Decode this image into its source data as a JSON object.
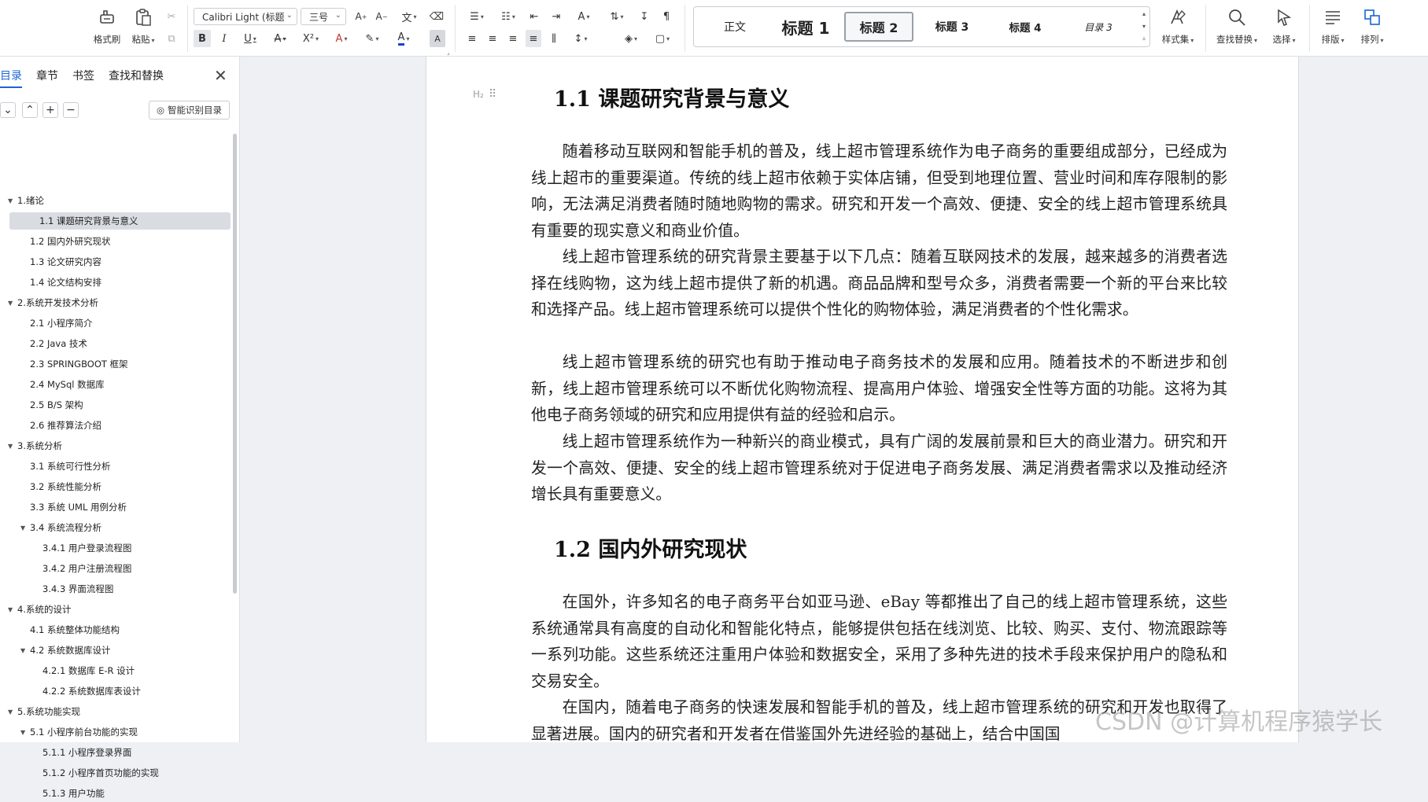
{
  "ribbon": {
    "clipboard": {
      "format_painter": "格式刷",
      "paste": "粘贴"
    },
    "font": {
      "family": "Calibri Light (标题",
      "size": "三号"
    },
    "styles": {
      "items": [
        "正文",
        "标题 1",
        "标题 2",
        "标题 3",
        "标题 4",
        "目录 3"
      ],
      "selected": "标题 2"
    },
    "right_buttons": {
      "style_set": "样式集",
      "find_replace": "查找替换",
      "select": "选择",
      "layout": "排版",
      "arrange": "排列"
    }
  },
  "nav": {
    "tabs": [
      "目录",
      "章节",
      "书签",
      "查找和替换"
    ],
    "active_tab": "目录",
    "smart_toc": "智能识别目录",
    "toc": [
      {
        "label": "1.绪论",
        "level": 1,
        "expanded": true
      },
      {
        "label": "1.1 课题研究背景与意义",
        "level": 2,
        "selected": true
      },
      {
        "label": "1.2 国内外研究现状",
        "level": 2
      },
      {
        "label": "1.3 论文研究内容",
        "level": 2
      },
      {
        "label": "1.4 论文结构安排",
        "level": 2
      },
      {
        "label": "2.系统开发技术分析",
        "level": 1,
        "expanded": true
      },
      {
        "label": "2.1 小程序简介",
        "level": 2
      },
      {
        "label": "2.2 Java 技术",
        "level": 2
      },
      {
        "label": "2.3 SPRINGBOOT 框架",
        "level": 2
      },
      {
        "label": "2.4 MySql 数据库",
        "level": 2
      },
      {
        "label": "2.5 B/S 架构",
        "level": 2
      },
      {
        "label": "2.6 推荐算法介绍",
        "level": 2
      },
      {
        "label": "3.系统分析",
        "level": 1,
        "expanded": true
      },
      {
        "label": "3.1 系统可行性分析",
        "level": 2
      },
      {
        "label": "3.2 系统性能分析",
        "level": 2
      },
      {
        "label": "3.3 系统 UML 用例分析",
        "level": 2
      },
      {
        "label": "3.4 系统流程分析",
        "level": 2,
        "expanded": true
      },
      {
        "label": "3.4.1 用户登录流程图",
        "level": 3
      },
      {
        "label": "3.4.2 用户注册流程图",
        "level": 3
      },
      {
        "label": "3.4.3 界面流程图",
        "level": 3
      },
      {
        "label": "4.系统的设计",
        "level": 1,
        "expanded": true
      },
      {
        "label": "4.1 系统整体功能结构",
        "level": 2
      },
      {
        "label": "4.2 系统数据库设计",
        "level": 2,
        "expanded": true
      },
      {
        "label": "4.2.1 数据库 E-R 设计",
        "level": 3
      },
      {
        "label": "4.2.2 系统数据库表设计",
        "level": 3
      },
      {
        "label": "5.系统功能实现",
        "level": 1,
        "expanded": true
      },
      {
        "label": "5.1 小程序前台功能的实现",
        "level": 2,
        "expanded": true
      },
      {
        "label": "5.1.1 小程序登录界面",
        "level": 3
      },
      {
        "label": "5.1.2 小程序首页功能的实现",
        "level": 3
      },
      {
        "label": "5.1.3 用户功能",
        "level": 3
      }
    ]
  },
  "doc": {
    "heading_mark": "H₂",
    "sections": [
      {
        "heading": "1.1 课题研究背景与意义",
        "paragraphs": [
          "随着移动互联网和智能手机的普及，线上超市管理系统作为电子商务的重要组成部分，已经成为线上超市的重要渠道。传统的线上超市依赖于实体店铺，但受到地理位置、营业时间和库存限制的影响，无法满足消费者随时随地购物的需求。研究和开发一个高效、便捷、安全的线上超市管理系统具有重要的现实意义和商业价值。",
          "线上超市管理系统的研究背景主要基于以下几点：随着互联网技术的发展，越来越多的消费者选择在线购物，这为线上超市提供了新的机遇。商品品牌和型号众多，消费者需要一个新的平台来比较和选择产品。线上超市管理系统可以提供个性化的购物体验，满足消费者的个性化需求。",
          "线上超市管理系统的研究也有助于推动电子商务技术的发展和应用。随着技术的不断进步和创新，线上超市管理系统可以不断优化购物流程、提高用户体验、增强安全性等方面的功能。这将为其他电子商务领域的研究和应用提供有益的经验和启示。",
          "线上超市管理系统作为一种新兴的商业模式，具有广阔的发展前景和巨大的商业潜力。研究和开发一个高效、便捷、安全的线上超市管理系统对于促进电子商务发展、满足消费者需求以及推动经济增长具有重要意义。"
        ]
      },
      {
        "heading": "1.2 国内外研究现状",
        "paragraphs": [
          "在国外，许多知名的电子商务平台如亚马逊、eBay 等都推出了自己的线上超市管理系统，这些系统通常具有高度的自动化和智能化特点，能够提供包括在线浏览、比较、购买、支付、物流跟踪等一系列功能。这些系统还注重用户体验和数据安全，采用了多种先进的技术手段来保护用户的隐私和交易安全。",
          "在国内，随着电子商务的快速发展和智能手机的普及，线上超市管理系统的研究和开发也取得了显著进展。国内的研究者和开发者在借鉴国外先进经验的基础上，结合中国国"
        ]
      }
    ],
    "watermark": "CSDN @计算机程序猿学长"
  },
  "colors": {
    "accent": "#1a66d1",
    "font_color": "#1a3fd1",
    "selection_bg": "#d9dce1"
  }
}
